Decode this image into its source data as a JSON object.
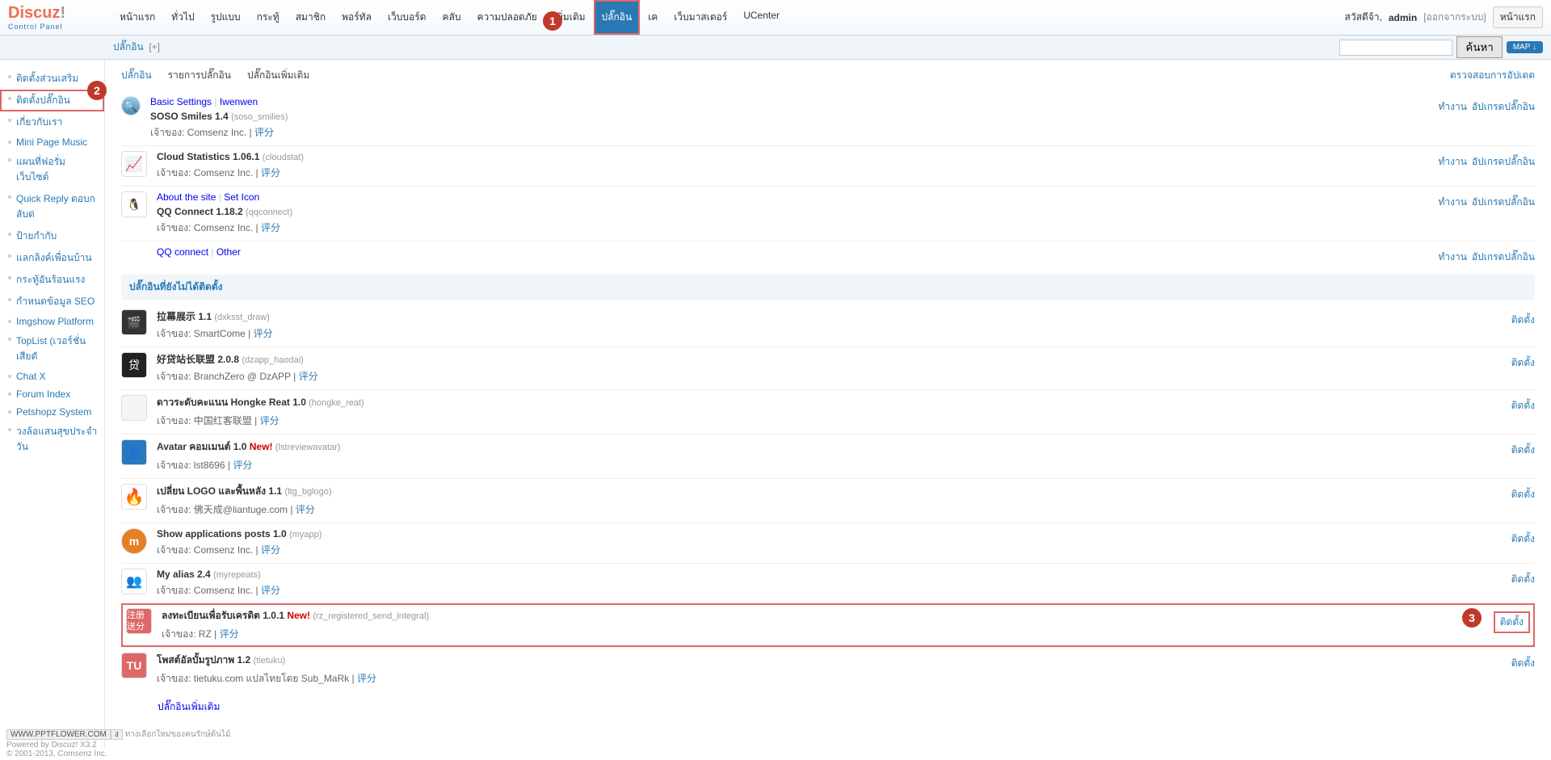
{
  "logo": {
    "name": "Discuz",
    "excl": "!",
    "sub": "Control Panel"
  },
  "topnav": {
    "items": [
      {
        "label": "หน้าแรก"
      },
      {
        "label": "ทั่วไป"
      },
      {
        "label": "รูปแบบ"
      },
      {
        "label": "กระทู้"
      },
      {
        "label": "สมาชิก"
      },
      {
        "label": "พอร์ทัล"
      },
      {
        "label": "เว็บบอร์ด"
      },
      {
        "label": "คลับ"
      },
      {
        "label": "ความปลอดภัย"
      },
      {
        "label": "เพิ่มเติม"
      },
      {
        "label": "ปลั๊กอิน",
        "active": true
      },
      {
        "label": "เค"
      },
      {
        "label": "เว็บมาสเตอร์"
      },
      {
        "label": "UCenter"
      }
    ]
  },
  "badges": {
    "b1": "1",
    "b2": "2",
    "b3": "3"
  },
  "user": {
    "greet": "สวัสดีจ้า,",
    "name": "admin",
    "logout": "[ออกจากระบบ]",
    "home": "หน้าแรก"
  },
  "subbar": {
    "crumb": "ปลั๊กอิน",
    "plus": "[+]",
    "search": "ค้นหา",
    "map": "MAP ↓"
  },
  "sidebar": {
    "items": [
      {
        "label": "ติดตั้งส่วนเสริม"
      },
      {
        "label": "ติดตั้งปลั๊กอิน",
        "sel": true
      },
      {
        "label": "เกี่ยวกับเรา"
      },
      {
        "label": "Mini Page Music"
      },
      {
        "label": "แผนที่ฟอรั่มเว็บไซต์"
      },
      {
        "label": "Quick Reply ตอบกลับด่"
      },
      {
        "label": "ป้ายกำกับ"
      },
      {
        "label": "แลกลิงค์เพื่อนบ้าน"
      },
      {
        "label": "กระทู้อันร้อนแรง"
      },
      {
        "label": "กำหนดข้อมูล SEO"
      },
      {
        "label": "Imgshow Platform"
      },
      {
        "label": "TopList (เวอร์ชั่นเสียตั"
      },
      {
        "label": "Chat X"
      },
      {
        "label": "Forum Index"
      },
      {
        "label": "Petshopz System"
      },
      {
        "label": "วงล้อแสนสุขประจำวัน"
      }
    ]
  },
  "tabs": {
    "items": [
      {
        "label": "ปลั๊กอิน",
        "active": true
      },
      {
        "label": "รายการปลั๊กอิน"
      },
      {
        "label": "ปลั๊กอินเพิ่มเติม"
      }
    ],
    "update": "ตรวจสอบการอัปเดต"
  },
  "installed": [
    {
      "meta1": "Basic Settings",
      "meta2": "Iwenwen",
      "name": "SOSO Smiles 1.4",
      "pid": "(soso_smilies)",
      "owner": "เจ้าของ: Comsenz Inc.",
      "act1": "ทำงาน",
      "act2": "อัปเกรดปลั๊กอิน",
      "icon": "soso",
      "iconTxt": "🔍"
    },
    {
      "meta1": "",
      "meta2": "",
      "name": "Cloud Statistics 1.06.1",
      "pid": "(cloudstat)",
      "owner": "เจ้าของ: Comsenz Inc.",
      "act1": "ทำงาน",
      "act2": "อัปเกรดปลั๊กอิน",
      "icon": "cloud",
      "iconTxt": "📈"
    },
    {
      "meta1": "About the site",
      "meta2": "Set Icon",
      "name": "QQ Connect 1.18.2",
      "pid": "(qqconnect)",
      "owner": "เจ้าของ: Comsenz Inc.",
      "act1": "ทำงาน",
      "act2": "อัปเกรดปลั๊กอิน",
      "icon": "qq",
      "iconTxt": "🐧"
    },
    {
      "meta1": "QQ connect",
      "meta2": "Other",
      "name": "",
      "pid": "",
      "owner": "",
      "act1": "ทำงาน",
      "act2": "อัปเกรดปลั๊กอิน",
      "noicon": true
    }
  ],
  "section": "ปลั๊กอินที่ยังไม่ได้ติดตั้ง",
  "rate": "评分",
  "sep": " | ",
  "install": "ติดตั้ง",
  "uninstalled": [
    {
      "name": "拉幕展示 1.1",
      "pid": "(dxksst_draw)",
      "owner": "เจ้าของ: SmartCome",
      "icon": "film",
      "iconTxt": "🎬"
    },
    {
      "name": "好贷站长联盟 2.0.8",
      "pid": "(dzapp_haodai)",
      "owner": "เจ้าของ: BranchZero @ DzAPP",
      "icon": "house",
      "iconTxt": "贷"
    },
    {
      "name": "ดาวระดับคะแนน Hongke Reat 1.0",
      "pid": "(hongke_reat)",
      "owner": "เจ้าของ: 中国红客联盟",
      "icon": "blank",
      "iconTxt": ""
    },
    {
      "name": "Avatar คอมเมนต์ 1.0",
      "new": "New!",
      "pid": "(lstreviewavatar)",
      "owner": "เจ้าของ: lst8696",
      "icon": "avatar",
      "iconTxt": "👤"
    },
    {
      "name": "เปลี่ยน LOGO และพื้นหลัง 1.1",
      "pid": "(ltg_bglogo)",
      "owner": "เจ้าของ: 佛天成@liantuge.com",
      "icon": "fire",
      "iconTxt": "🔥"
    },
    {
      "name": "Show applications posts 1.0",
      "pid": "(myapp)",
      "owner": "เจ้าของ: Comsenz Inc.",
      "icon": "m",
      "iconTxt": "m"
    },
    {
      "name": "My alias 2.4",
      "pid": "(myrepeats)",
      "owner": "เจ้าของ: Comsenz Inc.",
      "icon": "ppl",
      "iconTxt": "👥"
    },
    {
      "name": "ลงทะเบียนเพื่อรับเครดิต 1.0.1",
      "new": "New!",
      "pid": "(rz_registered_send_integral)",
      "owner": "เจ้าของ: RZ",
      "icon": "reg",
      "iconTxt": "注册送分",
      "hl": true
    },
    {
      "name": "โพสต์อัลบั้มรูปภาพ 1.2",
      "pid": "(tietuku)",
      "owner": "เจ้าของ: tietuku.com แปลไทยโดย Sub_MaRk",
      "icon": "tu",
      "iconTxt": "TU"
    }
  ],
  "more": "ปลั๊กอินเพิ่มเติม",
  "footer": {
    "wm": "WWW.PPTFLOWER.COM",
    "dropdown": "ง",
    "pow": "Powered by Discuz! X3.2",
    "copy": "© 2001-2013, Comsenz Inc.",
    "ext": "ทางเลือกใหม่ของคนรักษ์ต้นไม้"
  }
}
